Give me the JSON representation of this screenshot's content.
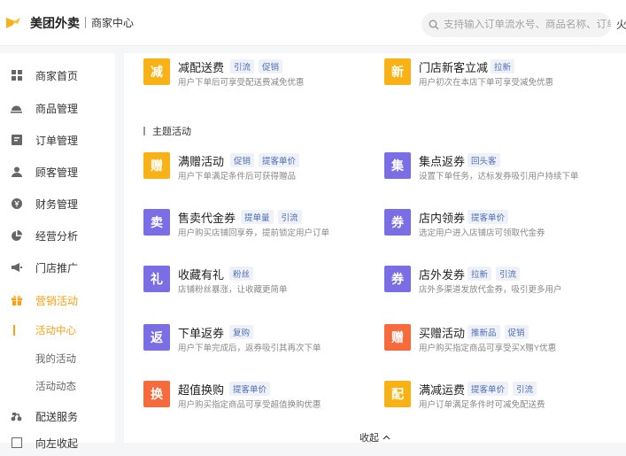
{
  "header": {
    "brand": "美团外卖",
    "sub": "商家中心",
    "search_placeholder": "支持输入订单流水号、商品名称、订单号",
    "right_cut": "火"
  },
  "sidebar": {
    "items": [
      {
        "label": "商家首页",
        "icon": "grid-icon"
      },
      {
        "label": "商品管理",
        "icon": "dish-icon"
      },
      {
        "label": "订单管理",
        "icon": "order-icon"
      },
      {
        "label": "顾客管理",
        "icon": "user-icon"
      },
      {
        "label": "财务管理",
        "icon": "yuan-icon"
      },
      {
        "label": "经营分析",
        "icon": "pie-icon"
      },
      {
        "label": "门店推广",
        "icon": "megaphone-icon"
      },
      {
        "label": "营销活动",
        "icon": "gift-icon"
      }
    ],
    "sub_items": [
      "活动中心",
      "我的活动",
      "活动动态"
    ],
    "more_items": [
      {
        "label": "配送服务",
        "icon": "delivery-icon"
      },
      {
        "label": "向左收起",
        "icon": "collapse-icon"
      }
    ]
  },
  "main": {
    "section_title": "主题活动",
    "collapse_label": "收起",
    "cards": [
      {
        "badge": "减",
        "color": "#f9b215",
        "title": "减配送费",
        "tags": [
          "引流",
          "促销"
        ],
        "desc": "用户下单后可享受配送费减免优惠"
      },
      {
        "badge": "新",
        "color": "#f9b215",
        "title": "门店新客立减",
        "tags": [
          "拉新"
        ],
        "desc": "用户初次在本店下单可享受减免优惠"
      },
      {
        "badge": "赠",
        "color": "#f9b215",
        "title": "满赠活动",
        "tags": [
          "促销",
          "提客单价"
        ],
        "desc": "用户下单满足条件后可获得赠品"
      },
      {
        "badge": "集",
        "color": "#7b6ee5",
        "title": "集点返券",
        "tags": [
          "回头客"
        ],
        "desc": "设置下单任务，达标发券吸引用户持续下单"
      },
      {
        "badge": "卖",
        "color": "#7b6ee5",
        "title": "售卖代金券",
        "tags": [
          "提单量",
          "引流"
        ],
        "desc": "用户购买店铺回享券，提前锁定用户订单"
      },
      {
        "badge": "券",
        "color": "#7b6ee5",
        "title": "店内领券",
        "tags": [
          "提客单价"
        ],
        "desc": "选定用户进入店铺店可领取代金券"
      },
      {
        "badge": "礼",
        "color": "#7b6ee5",
        "title": "收藏有礼",
        "tags": [
          "粉丝"
        ],
        "desc": "店铺粉丝暴涨，让收藏更简单"
      },
      {
        "badge": "券",
        "color": "#7b6ee5",
        "title": "店外发券",
        "tags": [
          "拉新",
          "引流"
        ],
        "desc": "店外多渠道发放代金券，吸引更多用户"
      },
      {
        "badge": "返",
        "color": "#7b6ee5",
        "title": "下单返券",
        "tags": [
          "复购"
        ],
        "desc": "用户下单完成后，返券吸引其再次下单"
      },
      {
        "badge": "赠",
        "color": "#f56b3c",
        "title": "买赠活动",
        "tags": [
          "推新品",
          "促销"
        ],
        "desc": "用户购买指定商品可享受买X赠Y优惠"
      },
      {
        "badge": "换",
        "color": "#f56b3c",
        "title": "超值换购",
        "tags": [
          "提客单价"
        ],
        "desc": "用户购买指定商品可享受超值换购优惠"
      },
      {
        "badge": "配",
        "color": "#f9b215",
        "title": "满减运费",
        "tags": [
          "提客单价",
          "引流"
        ],
        "desc": "用户订单满足条件时可减免配送费"
      }
    ]
  }
}
